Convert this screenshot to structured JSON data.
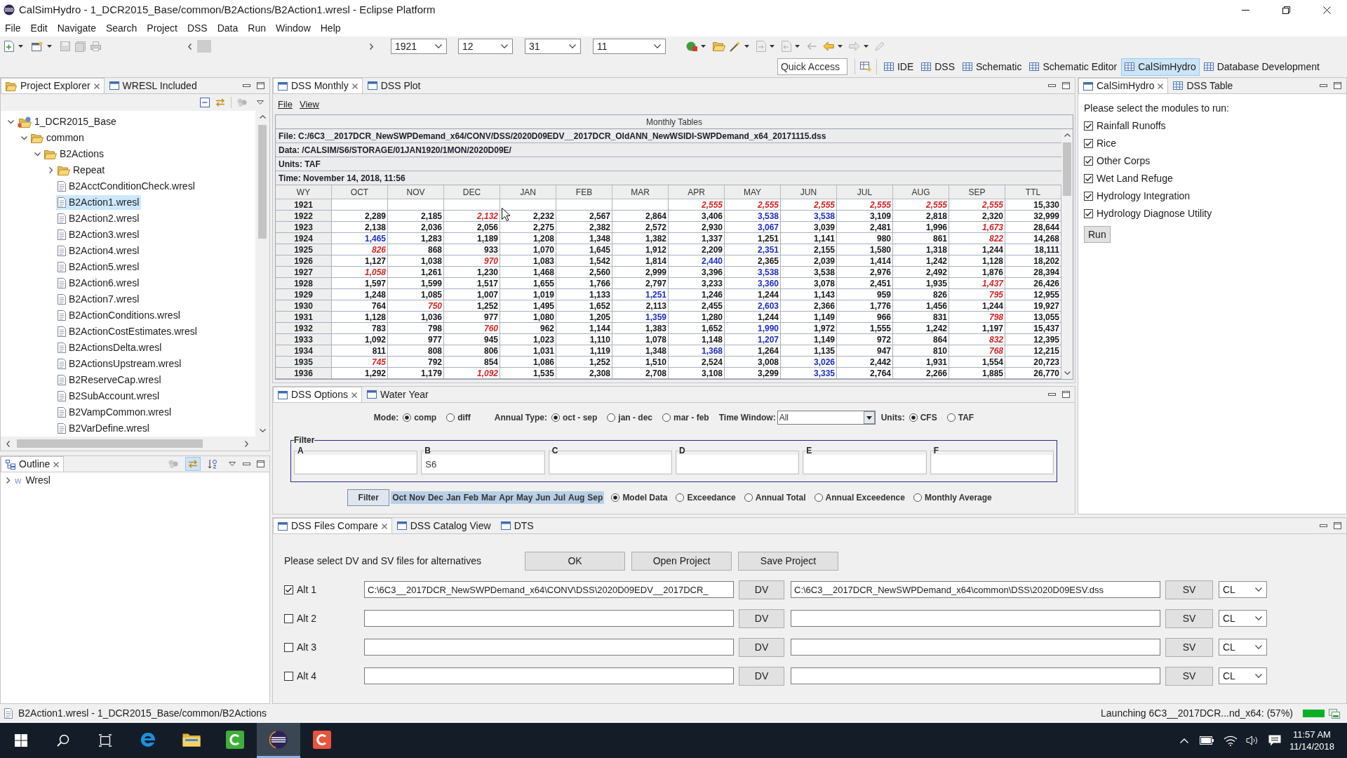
{
  "window": {
    "title": "CalSimHydro - 1_DCR2015_Base/common/B2Actions/B2Action1.wresl - Eclipse Platform"
  },
  "menu": [
    "File",
    "Edit",
    "Navigate",
    "Search",
    "Project",
    "DSS",
    "Data",
    "Run",
    "Window",
    "Help"
  ],
  "toolbar": {
    "combos": [
      "1921",
      "12",
      "31",
      "11"
    ]
  },
  "quick_access": {
    "placeholder": "Quick Access"
  },
  "perspectives": [
    {
      "label": "IDE",
      "selected": false
    },
    {
      "label": "DSS",
      "selected": false
    },
    {
      "label": "Schematic",
      "selected": false
    },
    {
      "label": "Schematic Editor",
      "selected": false
    },
    {
      "label": "CalSimHydro",
      "selected": true
    },
    {
      "label": "Database Development",
      "selected": false
    }
  ],
  "project_explorer": {
    "tabs": [
      {
        "label": "Project Explorer",
        "selected": true
      },
      {
        "label": "WRESL Included",
        "selected": false
      }
    ],
    "tree": [
      {
        "label": "1_DCR2015_Base",
        "kind": "project",
        "expanded": true,
        "selected": false,
        "children": [
          {
            "label": "common",
            "kind": "folder",
            "expanded": true,
            "selected": false,
            "children": [
              {
                "label": "B2Actions",
                "kind": "folder",
                "expanded": true,
                "selected": false,
                "children": [
                  {
                    "label": "Repeat",
                    "kind": "folder",
                    "expanded": false,
                    "selected": false
                  },
                  {
                    "label": "B2AcctConditionCheck.wresl",
                    "kind": "file",
                    "selected": false
                  },
                  {
                    "label": "B2Action1.wresl",
                    "kind": "file",
                    "selected": true
                  },
                  {
                    "label": "B2Action2.wresl",
                    "kind": "file",
                    "selected": false
                  },
                  {
                    "label": "B2Action3.wresl",
                    "kind": "file",
                    "selected": false
                  },
                  {
                    "label": "B2Action4.wresl",
                    "kind": "file",
                    "selected": false
                  },
                  {
                    "label": "B2Action5.wresl",
                    "kind": "file",
                    "selected": false
                  },
                  {
                    "label": "B2Action6.wresl",
                    "kind": "file",
                    "selected": false
                  },
                  {
                    "label": "B2Action7.wresl",
                    "kind": "file",
                    "selected": false
                  },
                  {
                    "label": "B2ActionConditions.wresl",
                    "kind": "file",
                    "selected": false
                  },
                  {
                    "label": "B2ActionCostEstimates.wresl",
                    "kind": "file",
                    "selected": false
                  },
                  {
                    "label": "B2ActionsDelta.wresl",
                    "kind": "file",
                    "selected": false
                  },
                  {
                    "label": "B2ActionsUpstream.wresl",
                    "kind": "file",
                    "selected": false
                  },
                  {
                    "label": "B2ReserveCap.wresl",
                    "kind": "file",
                    "selected": false
                  },
                  {
                    "label": "B2SubAccount.wresl",
                    "kind": "file",
                    "selected": false
                  },
                  {
                    "label": "B2VampCommon.wresl",
                    "kind": "file",
                    "selected": false
                  },
                  {
                    "label": "B2VarDefine.wresl",
                    "kind": "file",
                    "selected": false
                  }
                ]
              }
            ]
          }
        ]
      }
    ]
  },
  "outline": {
    "tabs": [
      {
        "label": "Outline",
        "selected": true
      }
    ],
    "tools": [
      {
        "on": false
      },
      {
        "on": true
      },
      {
        "on": false
      }
    ],
    "tree": [
      {
        "label": "Wresl",
        "glyph": "w",
        "expanded": false,
        "selected": false
      }
    ]
  },
  "monthly": {
    "tabs": [
      {
        "label": "DSS Monthly",
        "selected": true
      },
      {
        "label": "DSS Plot",
        "selected": false
      }
    ],
    "menu": [
      "File",
      "View"
    ],
    "title": "Monthly Tables",
    "info": [
      "File: C:/6C3__2017DCR_NewSWPDemand_x64/CONV/DSS/2020D09EDV__2017DCR_OldANN_NewWSIDI-SWPDemand_x64_20171115.dss",
      "Data: /CALSIM/S6/STORAGE/01JAN1920/1MON/2020D09E/",
      "Units: TAF",
      "Time: November 14, 2018, 11:56"
    ],
    "columns": [
      "WY",
      "OCT",
      "NOV",
      "DEC",
      "JAN",
      "FEB",
      "MAR",
      "APR",
      "MAY",
      "JUN",
      "JUL",
      "AUG",
      "SEP",
      "TTL"
    ],
    "rows": [
      {
        "wy": "1921",
        "cells": [
          null,
          null,
          null,
          null,
          null,
          null,
          {
            "text": "2,555",
            "kind": "min"
          },
          {
            "text": "2,555",
            "kind": "min"
          },
          {
            "text": "2,555",
            "kind": "min"
          },
          {
            "text": "2,555",
            "kind": "min"
          },
          {
            "text": "2,555",
            "kind": "min"
          },
          {
            "text": "2,555",
            "kind": "min"
          },
          "15,330"
        ]
      },
      {
        "wy": "1922",
        "cells": [
          "2,289",
          "2,185",
          {
            "text": "2,132",
            "kind": "min"
          },
          "2,232",
          "2,567",
          "2,864",
          "3,406",
          {
            "text": "3,538",
            "kind": "max"
          },
          {
            "text": "3,538",
            "kind": "max"
          },
          "3,109",
          "2,818",
          "2,320",
          "32,999"
        ]
      },
      {
        "wy": "1923",
        "cells": [
          "2,138",
          "2,036",
          "2,056",
          "2,275",
          "2,382",
          "2,572",
          "2,930",
          {
            "text": "3,067",
            "kind": "max"
          },
          "3,039",
          "2,481",
          "1,996",
          {
            "text": "1,673",
            "kind": "min"
          },
          "28,644"
        ]
      },
      {
        "wy": "1924",
        "cells": [
          {
            "text": "1,465",
            "kind": "max"
          },
          "1,283",
          "1,189",
          "1,208",
          "1,348",
          "1,382",
          "1,337",
          "1,251",
          "1,141",
          "980",
          "861",
          {
            "text": "822",
            "kind": "min"
          },
          "14,268"
        ]
      },
      {
        "wy": "1925",
        "cells": [
          {
            "text": "826",
            "kind": "min"
          },
          "868",
          "933",
          "1,070",
          "1,645",
          "1,912",
          "2,209",
          {
            "text": "2,351",
            "kind": "max"
          },
          "2,155",
          "1,580",
          "1,318",
          "1,244",
          "18,111"
        ]
      },
      {
        "wy": "1926",
        "cells": [
          "1,127",
          "1,038",
          {
            "text": "970",
            "kind": "min"
          },
          "1,083",
          "1,542",
          "1,814",
          {
            "text": "2,440",
            "kind": "max"
          },
          "2,365",
          "2,039",
          "1,414",
          "1,242",
          "1,128",
          "18,202"
        ]
      },
      {
        "wy": "1927",
        "cells": [
          {
            "text": "1,058",
            "kind": "min"
          },
          "1,261",
          "1,230",
          "1,468",
          "2,560",
          "2,999",
          "3,396",
          {
            "text": "3,538",
            "kind": "max"
          },
          "3,538",
          "2,976",
          "2,492",
          "1,876",
          "28,394"
        ]
      },
      {
        "wy": "1928",
        "cells": [
          "1,597",
          "1,599",
          "1,517",
          "1,655",
          "1,766",
          "2,797",
          "3,233",
          {
            "text": "3,360",
            "kind": "max"
          },
          "3,078",
          "2,451",
          "1,935",
          {
            "text": "1,437",
            "kind": "min"
          },
          "26,426"
        ]
      },
      {
        "wy": "1929",
        "cells": [
          "1,248",
          "1,085",
          "1,007",
          "1,019",
          "1,133",
          {
            "text": "1,251",
            "kind": "max"
          },
          "1,246",
          "1,244",
          "1,143",
          "959",
          "826",
          {
            "text": "795",
            "kind": "min"
          },
          "12,955"
        ]
      },
      {
        "wy": "1930",
        "cells": [
          "764",
          {
            "text": "750",
            "kind": "min"
          },
          "1,252",
          "1,495",
          "1,652",
          "2,113",
          "2,455",
          {
            "text": "2,603",
            "kind": "max"
          },
          "2,366",
          "1,776",
          "1,456",
          "1,244",
          "19,927"
        ]
      },
      {
        "wy": "1931",
        "cells": [
          "1,128",
          "1,036",
          "977",
          "1,080",
          "1,205",
          {
            "text": "1,359",
            "kind": "max"
          },
          "1,280",
          "1,244",
          "1,149",
          "966",
          "831",
          {
            "text": "798",
            "kind": "min"
          },
          "13,055"
        ]
      },
      {
        "wy": "1932",
        "cells": [
          "783",
          "798",
          {
            "text": "760",
            "kind": "min"
          },
          "962",
          "1,144",
          "1,383",
          "1,652",
          {
            "text": "1,990",
            "kind": "max"
          },
          "1,972",
          "1,555",
          "1,242",
          "1,197",
          "15,437"
        ]
      },
      {
        "wy": "1933",
        "cells": [
          "1,092",
          "977",
          "945",
          "1,023",
          "1,110",
          "1,078",
          "1,148",
          {
            "text": "1,207",
            "kind": "max"
          },
          "1,149",
          "972",
          "864",
          {
            "text": "832",
            "kind": "min"
          },
          "12,395"
        ]
      },
      {
        "wy": "1934",
        "cells": [
          "811",
          "808",
          "806",
          "1,031",
          "1,119",
          "1,348",
          {
            "text": "1,368",
            "kind": "max"
          },
          "1,264",
          "1,135",
          "947",
          "810",
          {
            "text": "768",
            "kind": "min"
          },
          "12,215"
        ]
      },
      {
        "wy": "1935",
        "cells": [
          {
            "text": "745",
            "kind": "min"
          },
          "792",
          "854",
          "1,086",
          "1,252",
          "1,510",
          "2,524",
          "3,008",
          {
            "text": "3,026",
            "kind": "max"
          },
          "2,442",
          "1,931",
          "1,554",
          "20,723"
        ]
      },
      {
        "wy": "1936",
        "cells": [
          "1,292",
          "1,179",
          {
            "text": "1,092",
            "kind": "min"
          },
          "1,535",
          "2,308",
          "2,708",
          "3,108",
          "3,299",
          {
            "text": "3,335",
            "kind": "max"
          },
          "2,764",
          "2,266",
          "1,885",
          "26,770"
        ]
      }
    ]
  },
  "options": {
    "tabs": [
      {
        "label": "DSS Options",
        "selected": true
      },
      {
        "label": "Water Year",
        "selected": false
      }
    ],
    "mode": {
      "label": "Mode:",
      "choices": [
        {
          "label": "comp",
          "selected": true
        },
        {
          "label": "diff",
          "selected": false
        }
      ]
    },
    "annual_type": {
      "label": "Annual Type:",
      "choices": [
        {
          "label": "oct - sep",
          "selected": true
        },
        {
          "label": "jan - dec",
          "selected": false
        },
        {
          "label": "mar - feb",
          "selected": false
        }
      ]
    },
    "time_window": {
      "label": "Time Window:",
      "value": "All"
    },
    "units": {
      "label": "Units:",
      "choices": [
        {
          "label": "CFS",
          "selected": true
        },
        {
          "label": "TAF",
          "selected": false
        }
      ]
    },
    "filter": {
      "title": "Filter",
      "fields": [
        {
          "label": "A"
        },
        {
          "label": "B",
          "value": "S6"
        },
        {
          "label": "C"
        },
        {
          "label": "D"
        },
        {
          "label": "E"
        },
        {
          "label": "F"
        }
      ]
    },
    "filter_button": "Filter",
    "months": [
      {
        "label": "Oct",
        "selected": true
      },
      {
        "label": "Nov",
        "selected": true
      },
      {
        "label": "Dec",
        "selected": true
      },
      {
        "label": "Jan",
        "selected": true
      },
      {
        "label": "Feb",
        "selected": true
      },
      {
        "label": "Mar",
        "selected": true
      },
      {
        "label": "Apr",
        "selected": true
      },
      {
        "label": "May",
        "selected": true
      },
      {
        "label": "Jun",
        "selected": true
      },
      {
        "label": "Jul",
        "selected": true
      },
      {
        "label": "Aug",
        "selected": true
      },
      {
        "label": "Sep",
        "selected": true
      }
    ],
    "views": [
      {
        "label": "Model Data",
        "selected": true
      },
      {
        "label": "Exceedance",
        "selected": false
      },
      {
        "label": "Annual Total",
        "selected": false
      },
      {
        "label": "Annual Exceedence",
        "selected": false
      },
      {
        "label": "Monthly Average",
        "selected": false
      }
    ]
  },
  "calsimhydro": {
    "tabs": [
      {
        "label": "CalSimHydro",
        "selected": true
      },
      {
        "label": "DSS Table",
        "selected": false
      }
    ],
    "prompt": "Please select the modules to run:",
    "modules": [
      {
        "label": "Rainfall Runoffs",
        "checked": true
      },
      {
        "label": "Rice",
        "checked": true
      },
      {
        "label": "Other Corps",
        "checked": true
      },
      {
        "label": "Wet Land Refuge",
        "checked": true
      },
      {
        "label": "Hydrology Integration",
        "checked": true
      },
      {
        "label": "Hydrology Diagnose Utility",
        "checked": true
      }
    ],
    "run_button": "Run"
  },
  "files_compare": {
    "tabs": [
      {
        "label": "DSS Files Compare",
        "selected": true
      },
      {
        "label": "DSS Catalog View",
        "selected": false
      },
      {
        "label": "DTS",
        "selected": false
      }
    ],
    "prompt": "Please select DV and SV files for alternatives",
    "buttons": [
      "OK",
      "Open Project",
      "Save Project"
    ],
    "alternatives": [
      {
        "label": "Alt 1",
        "checked": true,
        "dv_path": "C:\\6C3__2017DCR_NewSWPDemand_x64\\CONV\\DSS\\2020D09EDV__2017DCR_",
        "dv_button": "DV",
        "sv_path": "C:\\6C3__2017DCR_NewSWPDemand_x64\\common\\DSS\\2020D09ESV.dss",
        "sv_button": "SV",
        "type": "CL"
      },
      {
        "label": "Alt 2",
        "checked": false,
        "dv_button": "DV",
        "sv_button": "SV",
        "type": "CL"
      },
      {
        "label": "Alt 3",
        "checked": false,
        "dv_button": "DV",
        "sv_button": "SV",
        "type": "CL"
      },
      {
        "label": "Alt 4",
        "checked": false,
        "dv_button": "DV",
        "sv_button": "SV",
        "type": "CL"
      }
    ]
  },
  "status_bar": {
    "path": "B2Action1.wresl - 1_DCR2015_Base/common/B2Actions",
    "job": "Launching 6C3__2017DCR...nd_x64: (57%)",
    "progress": {
      "level": 1
    }
  },
  "taskbar": {
    "apps": [
      {
        "kind": "browser",
        "selected": false
      },
      {
        "kind": "folder",
        "selected": false
      },
      {
        "kind": "recorder",
        "selected": false
      },
      {
        "kind": "ide",
        "selected": true
      },
      {
        "kind": "studio",
        "selected": false
      }
    ],
    "time": "11:57 AM",
    "date": "11/14/2018"
  }
}
